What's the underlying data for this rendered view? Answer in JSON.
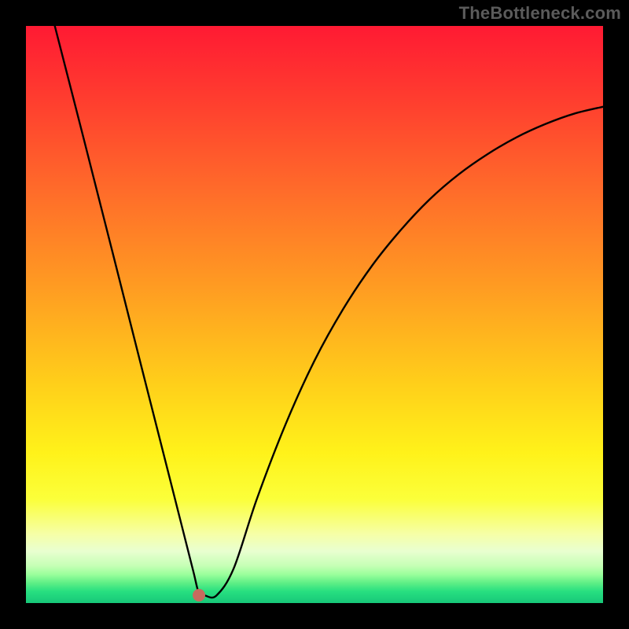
{
  "watermark": "TheBottleneck.com",
  "chart_data": {
    "type": "line",
    "title": "",
    "xlabel": "",
    "ylabel": "",
    "xlim": [
      0,
      100
    ],
    "ylim": [
      0,
      100
    ],
    "grid": false,
    "legend": false,
    "series": [
      {
        "name": "curve",
        "x": [
          5,
          10,
          15,
          20,
          25,
          27,
          29,
          30,
          31,
          33,
          36,
          40,
          45,
          50,
          55,
          60,
          65,
          70,
          75,
          80,
          85,
          90,
          95,
          100
        ],
        "y": [
          100,
          80.5,
          60.8,
          41.0,
          21.3,
          13.4,
          5.5,
          1.6,
          1.3,
          1.3,
          6.0,
          18.0,
          31.0,
          42.0,
          51.0,
          58.5,
          64.7,
          70.0,
          74.3,
          77.8,
          80.7,
          83.0,
          84.8,
          86.0
        ],
        "color": "#000000"
      }
    ],
    "marker": {
      "x": 30,
      "y": 1.3,
      "color": "#c76b5e"
    },
    "background_gradient": {
      "orientation": "vertical",
      "stops": [
        {
          "pos": 0.0,
          "color": "#ff1a33"
        },
        {
          "pos": 0.28,
          "color": "#ff6a2a"
        },
        {
          "pos": 0.62,
          "color": "#ffcf1a"
        },
        {
          "pos": 0.82,
          "color": "#fbff3a"
        },
        {
          "pos": 0.95,
          "color": "#9cff9c"
        },
        {
          "pos": 1.0,
          "color": "#17c779"
        }
      ]
    }
  }
}
